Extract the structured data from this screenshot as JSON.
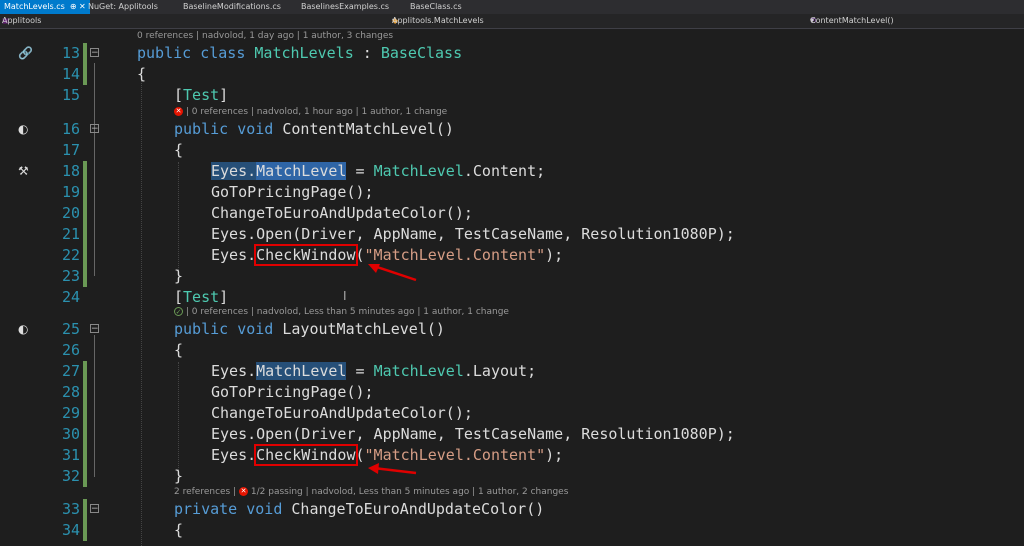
{
  "tabs": [
    {
      "label": "MatchLevels.cs",
      "active": true
    },
    {
      "label": "NuGet: Applitools",
      "active": false
    },
    {
      "label": "BaselineModifications.cs",
      "active": false
    },
    {
      "label": "BaselinesExamples.cs",
      "active": false
    },
    {
      "label": "BaseClass.cs",
      "active": false
    }
  ],
  "tab_pin": "⊕ ✕",
  "nav": {
    "project": "Applitools",
    "type": "Applitools.MatchLevels",
    "member": "ContentMatchLevel()"
  },
  "lenses": {
    "l13": "0 references | nadvolod, 1 day ago | 1 author, 3 changes",
    "l16": "| 0 references | nadvolod, 1 hour ago | 1 author, 1 change",
    "l25": "| 0 references | nadvolod, Less than 5 minutes ago | 1 author, 1 change",
    "l33_a": "2 references |",
    "l33_b": "1/2 passing | nadvolod, Less than 5 minutes ago | 1 author, 2 changes"
  },
  "lines": {
    "n13": "13",
    "n14": "14",
    "n15": "15",
    "n16": "16",
    "n17": "17",
    "n18": "18",
    "n19": "19",
    "n20": "20",
    "n21": "21",
    "n22": "22",
    "n23": "23",
    "n24": "24",
    "n25": "25",
    "n26": "26",
    "n27": "27",
    "n28": "28",
    "n29": "29",
    "n30": "30",
    "n31": "31",
    "n32": "32",
    "n33": "33",
    "n34": "34"
  },
  "code": {
    "kw_public": "public",
    "kw_class": "class",
    "kw_void": "void",
    "kw_private": "private",
    "class_name": "MatchLevels",
    "colon": " : ",
    "base_class": "BaseClass",
    "open_brace": "{",
    "close_brace": "}",
    "test_attr_open": "[",
    "test_attr_name": "Test",
    "test_attr_close": "]",
    "m_content": "ContentMatchLevel()",
    "m_layout": "LayoutMatchLevel()",
    "m_change": "ChangeToEuroAndUpdateColor()",
    "eyes_dot": "Eyes.",
    "match_level_prop": "MatchLevel",
    "assign_content_a": " = ",
    "enum_type": "MatchLevel",
    "enum_content": ".Content;",
    "enum_layout": ".Layout;",
    "goto_pricing": "GoToPricingPage();",
    "change_euro": "ChangeToEuroAndUpdateColor();",
    "open_call": "Eyes.Open(Driver, AppName, TestCaseName, Resolution1080P);",
    "check_window": "CheckWindow",
    "paren_open": "(",
    "check_str": "\"MatchLevel.Content\"",
    "paren_close": ");"
  },
  "colors": {
    "keyword": "#569cd6",
    "type": "#4ec9b0",
    "string": "#d69d85",
    "line_number": "#2b91af",
    "annotation_red": "#e00000"
  }
}
